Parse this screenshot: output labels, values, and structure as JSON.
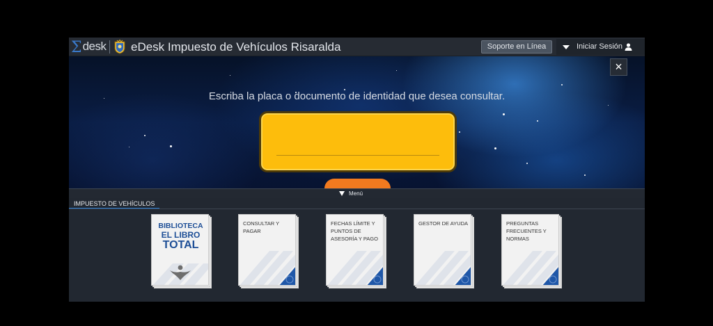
{
  "header": {
    "logo_text": "desk",
    "app_title": "eDesk Impuesto de Vehículos Risaralda",
    "support_button": "Soporte en Línea",
    "login_label": "Iniciar Sesión"
  },
  "banner": {
    "prompt": "Escriba la placa o documento de identidad que desea consultar.",
    "close_symbol": "×",
    "plate_input_value": ""
  },
  "menu": {
    "toggle_label": "Menú"
  },
  "section": {
    "tab_label": "IMPUESTO DE VEHÍCULOS"
  },
  "cards": [
    {
      "line1": "BIBLIOTECA",
      "line2": "EL LIBRO",
      "line3": "TOTAL"
    },
    {
      "title": "CONSULTAR Y PAGAR"
    },
    {
      "title": "FECHAS LÍMITE Y PUNTOS DE ASESORÍA Y PAGO"
    },
    {
      "title": "GESTOR DE AYUDA"
    },
    {
      "title": "PREGUNTAS FRECUENTES Y NORMAS"
    }
  ],
  "colors": {
    "plate_yellow": "#fdbd0c",
    "accent_blue": "#2d7dd2",
    "orange_tab": "#f27a1f",
    "card_corner_blue": "#1f57a8"
  }
}
